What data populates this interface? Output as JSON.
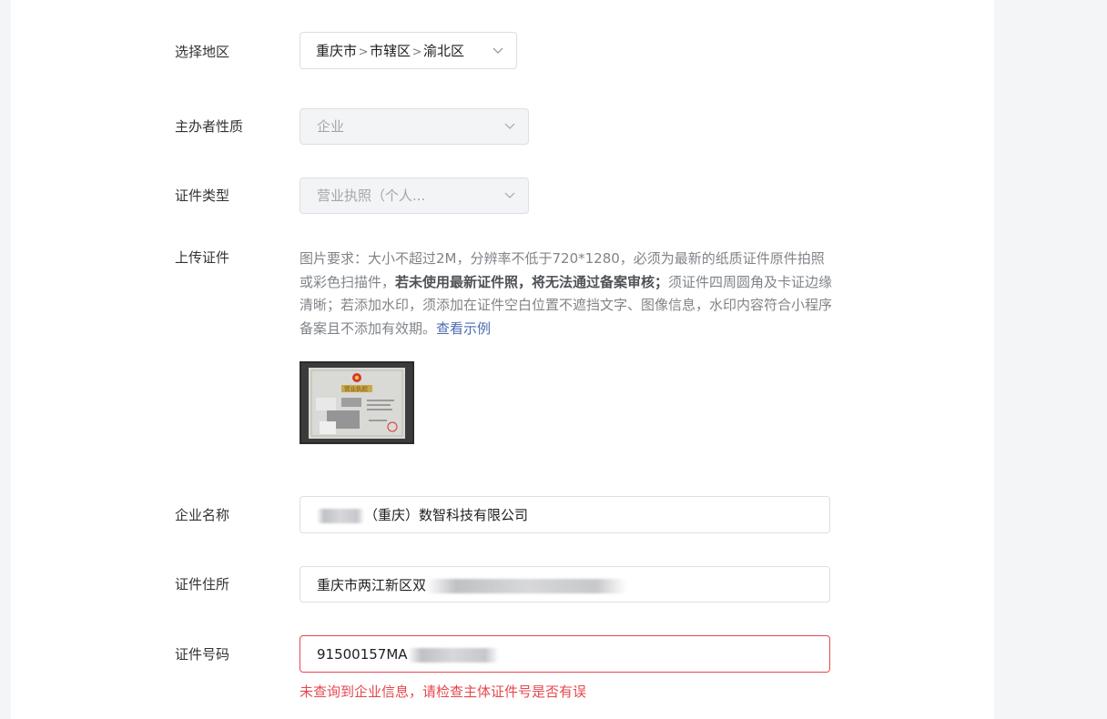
{
  "form": {
    "region": {
      "label": "选择地区",
      "province": "重庆市",
      "city": "市辖区",
      "district": "渝北区",
      "separator": ">"
    },
    "organizer_type": {
      "label": "主办者性质",
      "value": "企业"
    },
    "certificate_type": {
      "label": "证件类型",
      "value": "营业执照（个人..."
    },
    "upload": {
      "label": "上传证件",
      "desc_part1": "图片要求：大小不超过2M，分辨率不低于720*1280，必须为最新的纸质证件原件拍照或彩色扫描件，",
      "desc_bold": "若未使用最新证件照，将无法通过备案审核；",
      "desc_part2": "须证件四周圆角及卡证边缘清晰；若添加水印，须添加在证件空白位置不遮挡文字、图像信息，水印内容符合小程序备案且不添加有效期。",
      "example_link": "查看示例",
      "thumbnail_title": "营业执照"
    },
    "company_name": {
      "label": "企业名称",
      "value_visible": "（重庆）数智科技有限公司"
    },
    "address": {
      "label": "证件住所",
      "value_visible": "重庆市两江新区双"
    },
    "cert_number": {
      "label": "证件号码",
      "value_visible": "91500157MA",
      "error": "未查询到企业信息，请检查主体证件号是否有误"
    }
  },
  "colors": {
    "error": "#e5484d",
    "link": "#4a6bb0",
    "border": "#dcdfe6",
    "disabled_bg": "#f3f4f5"
  }
}
